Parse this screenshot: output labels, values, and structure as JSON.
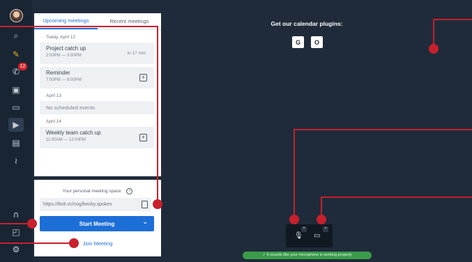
{
  "rail": {
    "icons": [
      "search-icon",
      "meetings-icon",
      "phone-icon",
      "contacts-icon",
      "chat-icon",
      "video-icon",
      "document-icon",
      "voicemail-icon",
      "headset-icon",
      "cast-icon",
      "settings-icon"
    ],
    "badge_count": "12"
  },
  "tabs": [
    {
      "label": "Upcoming meetings",
      "active": true
    },
    {
      "label": "Recent meetings",
      "active": false
    }
  ],
  "meetings": {
    "day1": "Today, April 12",
    "item1_title": "Project catch up",
    "item1_time": "2:00PM — 3:00PM",
    "item1_in": "in 17 min",
    "item2_title": "Reminder",
    "item2_time": "7:00PM — 8:00PM",
    "day2": "April 13",
    "no_events": "No scheduled events",
    "day3": "April 14",
    "item3_title": "Weekly team catch up",
    "item3_time": "11:00AM — 12:00PM"
  },
  "space": {
    "caption": "Your personal meeting space",
    "url": "https://8x8.vc/nog/becky.spokes",
    "start_label": "Start Meeting",
    "join_label": "Join Meeting"
  },
  "plugins": {
    "title": "Get our calendar plugins:",
    "google": "G",
    "office": "O"
  },
  "toast": "✓  It sounds like your microphone is working properly",
  "colors": {
    "accent": "#1d6fd8",
    "callout": "#c8202d",
    "success": "#3a9c4a"
  }
}
